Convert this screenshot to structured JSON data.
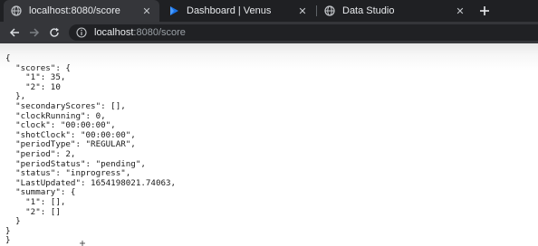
{
  "tabs": [
    {
      "title": "localhost:8080/score",
      "active": true,
      "icon": "globe-icon"
    },
    {
      "title": "Dashboard | Venus",
      "active": false,
      "icon": "venus-logo-icon"
    },
    {
      "title": "Data Studio",
      "active": false,
      "icon": "globe-icon"
    }
  ],
  "toolbar": {
    "url_host": "localhost",
    "url_rest": ":8080/score"
  },
  "colors": {
    "tabstrip_bg": "#1f2023",
    "toolbar_bg": "#35363a",
    "omnibox_bg": "#202124",
    "accent_blue": "#1a73e8"
  },
  "json_lines": [
    "{",
    "  \"scores\": {",
    "    \"1\": 35,",
    "    \"2\": 10",
    "  },",
    "  \"secondaryScores\": [],",
    "  \"clockRunning\": 0,",
    "  \"clock\": \"00:00:00\",",
    "  \"shotClock\": \"00:00:00\",",
    "  \"periodType\": \"REGULAR\",",
    "  \"period\": 2,",
    "  \"periodStatus\": \"pending\",",
    "  \"status\": \"inprogress\",",
    "  \"LastUpdated\": 1654198021.74063,",
    "  \"summary\": {",
    "    \"1\": [],",
    "    \"2\": []",
    "  }",
    "}",
    "}"
  ]
}
